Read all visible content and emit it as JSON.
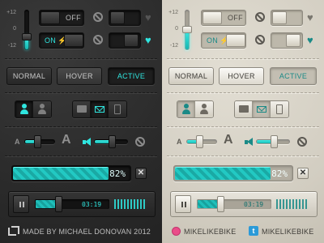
{
  "colors": {
    "accent": "#2fe6e0",
    "accent_light_theme": "#1a8a87",
    "dark_bg": "#2e2e2e",
    "light_bg": "#d8d4c8",
    "dribbble": "#ea4c89",
    "twitter": "#2b9ad8"
  },
  "volume": {
    "scale_top": "+12",
    "scale_mid": "0",
    "scale_bottom": "-12",
    "level_dark": 0.35,
    "level_light": 0.55
  },
  "toggles": {
    "off_label": "OFF",
    "on_label": "ON",
    "bolt": "⚡",
    "heart": "♥",
    "icons": [
      "toggle-switch-icon",
      "no-entry-icon",
      "heart-icon",
      "bolt-icon"
    ]
  },
  "buttons": {
    "normal": "NORMAL",
    "hover": "HOVER",
    "active": "ACTIVE"
  },
  "segments": {
    "group1": [
      "user-icon",
      "user-icon"
    ],
    "group2": [
      "chat-icon",
      "mail-icon",
      "phone-icon"
    ]
  },
  "sliders": {
    "font_small": "A",
    "font_large": "A",
    "font_size_level": 0.45,
    "volume_level": 0.55
  },
  "progress": {
    "percent": 82,
    "label": "82%",
    "close": "✕"
  },
  "player": {
    "time": "03:19",
    "position": 0.32
  },
  "footer": {
    "credit": "MADE BY MICHAEL DONOVAN 2012",
    "dribbble": "MIKELIKEBIKE",
    "twitter": "MIKELIKEBIKE",
    "twitter_glyph": "t"
  }
}
